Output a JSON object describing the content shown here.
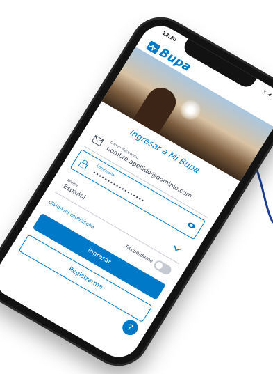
{
  "status": {
    "time": "12:30",
    "icons": "▾ ◢ ▮"
  },
  "brand": {
    "name": "Bupa",
    "color": "#0079c8"
  },
  "login": {
    "title": "Ingresar a Mi Bupa",
    "email": {
      "label": "Correo electrónico",
      "value": "nombre.apellido@dominio.com",
      "icon": "mail-icon"
    },
    "password": {
      "label": "Contraseña",
      "value": "••••••••••••••••••",
      "icon": "lock-icon",
      "toggle_icon": "eye-icon"
    },
    "language": {
      "label": "Idioma",
      "value": "Español"
    },
    "forgot_link": "Olvidé mi contraseña",
    "remember_label": "Recuérdame",
    "remember_checked": false,
    "submit_label": "Ingresar",
    "register_label": "Registrarme",
    "help_label": "?"
  },
  "wave_color": "#1c3f93"
}
